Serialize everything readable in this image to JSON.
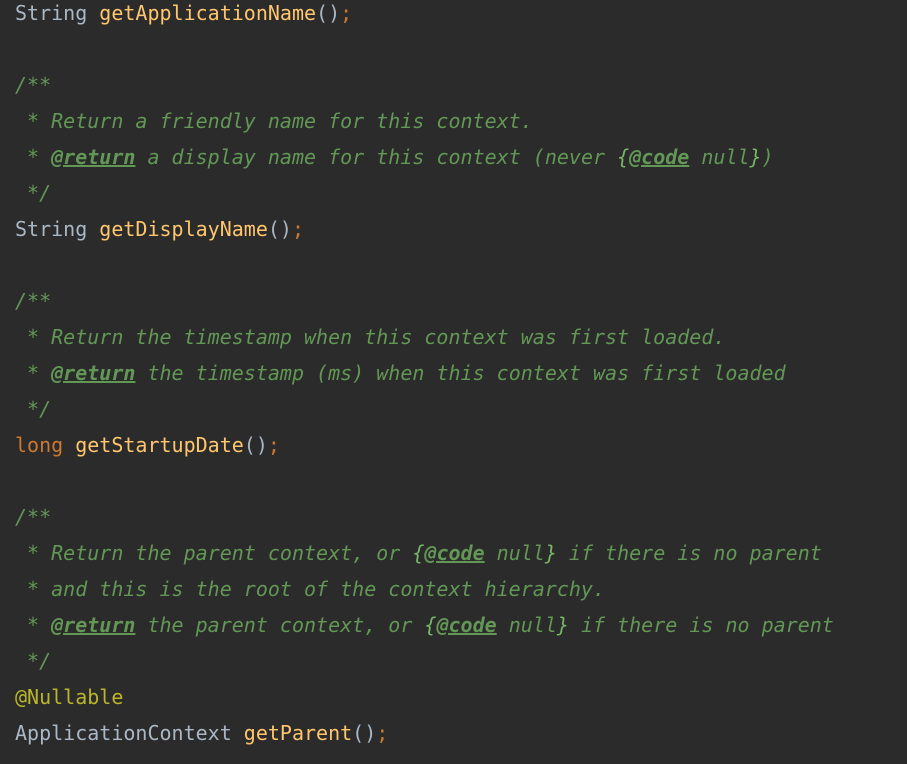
{
  "colors": {
    "background": "#2b2b2b",
    "identifier": "#a9b7c6",
    "keyword": "#cc7832",
    "method": "#ffc66d",
    "annotation": "#bbb529",
    "javadoc": "#629755"
  },
  "code": {
    "decl_app_name": {
      "type": "String",
      "space": " ",
      "method": "getApplicationName",
      "parens": "()",
      "semi": ";"
    },
    "doc_display_name": {
      "open": "/**",
      "line1": " * Return a friendly name for this context.",
      "line2_prefix": " * ",
      "line2_tag": "@return",
      "line2_text": " a display name for this context (never ",
      "line2_brace_open": "{",
      "line2_code_tag": "@code",
      "line2_code_text": " null",
      "line2_brace_close": "}",
      "line2_end": ")",
      "close": " */"
    },
    "decl_display_name": {
      "type": "String",
      "space": " ",
      "method": "getDisplayName",
      "parens": "()",
      "semi": ";"
    },
    "doc_startup_date": {
      "open": "/**",
      "line1": " * Return the timestamp when this context was first loaded.",
      "line2_prefix": " * ",
      "line2_tag": "@return",
      "line2_text": " the timestamp (ms) when this context was first loaded",
      "close": " */"
    },
    "decl_startup_date": {
      "keyword": "long",
      "space": " ",
      "method": "getStartupDate",
      "parens": "()",
      "semi": ";"
    },
    "doc_parent": {
      "open": "/**",
      "line1_text": " * Return the parent context, or ",
      "line1_brace_open": "{",
      "line1_code_tag": "@code",
      "line1_code_text": " null",
      "line1_brace_close": "}",
      "line1_end": " if there is no parent",
      "line2": " * and this is the root of the context hierarchy.",
      "line3_prefix": " * ",
      "line3_tag": "@return",
      "line3_text": " the parent context, or ",
      "line3_brace_open": "{",
      "line3_code_tag": "@code",
      "line3_code_text": " null",
      "line3_brace_close": "}",
      "line3_end": " if there is no parent",
      "close": " */"
    },
    "annotation_nullable": "@Nullable",
    "decl_parent": {
      "type": "ApplicationContext",
      "space": " ",
      "method": "getParent",
      "parens": "()",
      "semi": ";"
    }
  }
}
